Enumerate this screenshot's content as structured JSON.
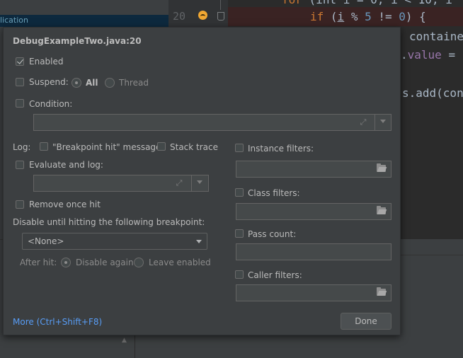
{
  "background": {
    "sidebar_text": "lication",
    "line_number": "20",
    "code": {
      "line1_kw": "for",
      "line1_rest": "(int i = 0; i < 10; i",
      "line2_kw": "if",
      "line2_open": "(",
      "line2_var": "i",
      "line2_op": " % ",
      "line2_num1": "5",
      "line2_neq": " != ",
      "line2_num2": "0",
      "line2_close": ") {",
      "line3": "containe",
      "line4_dot": ".",
      "line4_field": "value",
      "line4_rest": " =",
      "line5": "s.add(con"
    }
  },
  "dialog": {
    "title": "DebugExampleTwo.java:20",
    "enabled": {
      "label": "Enabled",
      "checked": true
    },
    "suspend": {
      "label": "Suspend:",
      "checked": false,
      "all": "All",
      "thread": "Thread",
      "selected": "All"
    },
    "condition": {
      "label": "Condition:",
      "checked": false,
      "value": ""
    },
    "log": {
      "label": "Log:",
      "breakpoint_hit": "\"Breakpoint hit\" message",
      "stack_trace": "Stack trace"
    },
    "evaluate_and_log": {
      "label": "Evaluate and log:",
      "checked": false,
      "value": ""
    },
    "remove_once_hit": {
      "label": "Remove once hit",
      "checked": false
    },
    "disable_until": {
      "label": "Disable until hitting the following breakpoint:",
      "selected": "<None>"
    },
    "after_hit": {
      "label": "After hit:",
      "disable_again": "Disable again",
      "leave_enabled": "Leave enabled",
      "selected": "Disable again"
    },
    "filters": {
      "instance": {
        "label": "Instance filters:",
        "value": ""
      },
      "class": {
        "label": "Class filters:",
        "value": ""
      },
      "pass_count": {
        "label": "Pass count:",
        "value": ""
      },
      "caller": {
        "label": "Caller filters:",
        "value": ""
      }
    },
    "more_link": "More (Ctrl+Shift+F8)",
    "done_button": "Done"
  }
}
